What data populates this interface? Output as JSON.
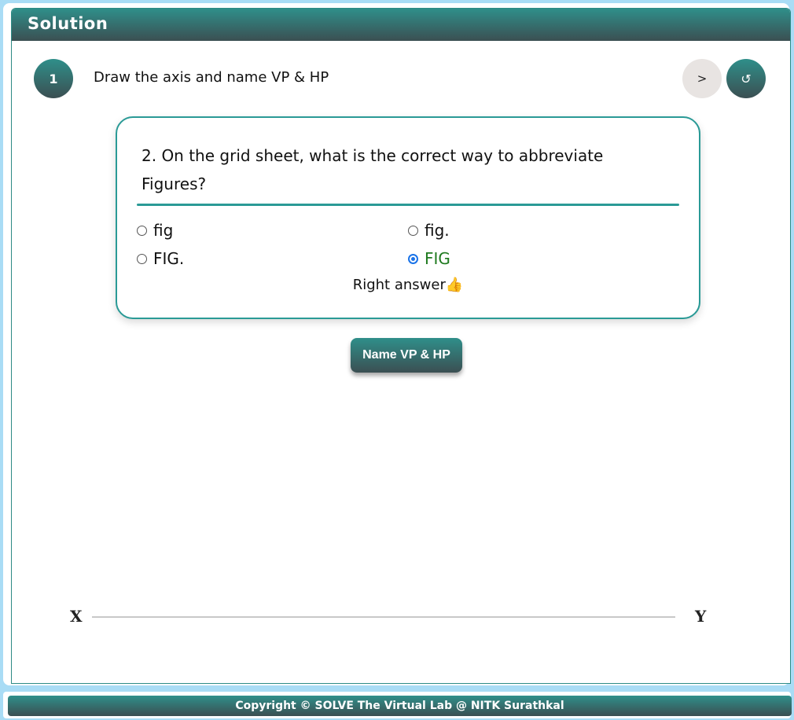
{
  "panel": {
    "title": "Solution"
  },
  "step": {
    "number": "1",
    "instruction": "Draw the axis and name VP & HP",
    "next_label": ">",
    "reset_label": "↺"
  },
  "quiz": {
    "question": "2. On the grid sheet, what is the correct way to abbreviate Figures?",
    "options": [
      {
        "label": "fig",
        "selected": false
      },
      {
        "label": "fig.",
        "selected": false
      },
      {
        "label": "FIG.",
        "selected": false
      },
      {
        "label": "FIG",
        "selected": true,
        "correct": true
      }
    ],
    "feedback": "Right answer",
    "feedback_icon": "👍",
    "correct_color": "#1f7a1f"
  },
  "action": {
    "button_label": "Name VP & HP"
  },
  "drawing": {
    "axis_left_label": "X",
    "axis_right_label": "Y"
  },
  "footer": {
    "text": "Copyright © SOLVE The Virtual Lab @ NITK Surathkal"
  },
  "colors": {
    "accent": "#2f8f8a",
    "accent_dark": "#3b4f52",
    "background": "#a9dcf5"
  }
}
